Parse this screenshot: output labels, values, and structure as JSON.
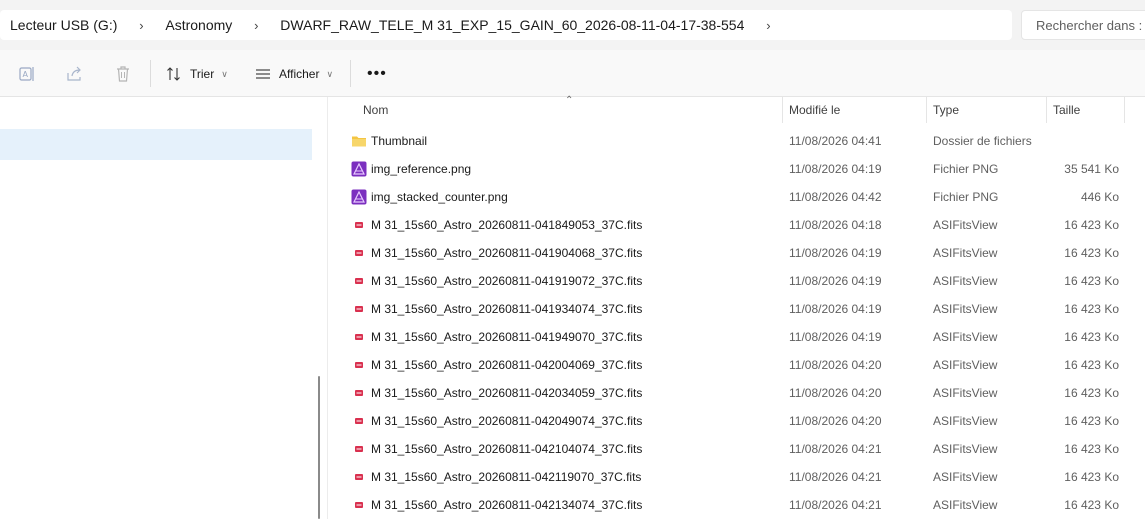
{
  "address": {
    "crumbs": [
      "Lecteur USB (G:)",
      "Astronomy",
      "DWARF_RAW_TELE_M 31_EXP_15_GAIN_60_2026-08-11-04-17-38-554"
    ],
    "search_placeholder": "Rechercher dans : DWARF_RAW"
  },
  "toolbar": {
    "sort_label": "Trier",
    "view_label": "Afficher"
  },
  "columns": {
    "name": "Nom",
    "modified": "Modifié le",
    "type": "Type",
    "size": "Taille"
  },
  "files": [
    {
      "name": "Thumbnail",
      "modified": "11/08/2026 04:41",
      "type": "Dossier de fichiers",
      "size": "",
      "icon": "folder-icon"
    },
    {
      "name": "img_reference.png",
      "modified": "11/08/2026 04:19",
      "type": "Fichier PNG",
      "size": "35 541 Ko",
      "icon": "png-file-icon"
    },
    {
      "name": "img_stacked_counter.png",
      "modified": "11/08/2026 04:42",
      "type": "Fichier PNG",
      "size": "446 Ko",
      "icon": "png-file-icon"
    },
    {
      "name": "M 31_15s60_Astro_20260811-041849053_37C.fits",
      "modified": "11/08/2026 04:18",
      "type": "ASIFitsView",
      "size": "16 423 Ko",
      "icon": "fits-file-icon"
    },
    {
      "name": "M 31_15s60_Astro_20260811-041904068_37C.fits",
      "modified": "11/08/2026 04:19",
      "type": "ASIFitsView",
      "size": "16 423 Ko",
      "icon": "fits-file-icon"
    },
    {
      "name": "M 31_15s60_Astro_20260811-041919072_37C.fits",
      "modified": "11/08/2026 04:19",
      "type": "ASIFitsView",
      "size": "16 423 Ko",
      "icon": "fits-file-icon"
    },
    {
      "name": "M 31_15s60_Astro_20260811-041934074_37C.fits",
      "modified": "11/08/2026 04:19",
      "type": "ASIFitsView",
      "size": "16 423 Ko",
      "icon": "fits-file-icon"
    },
    {
      "name": "M 31_15s60_Astro_20260811-041949070_37C.fits",
      "modified": "11/08/2026 04:19",
      "type": "ASIFitsView",
      "size": "16 423 Ko",
      "icon": "fits-file-icon"
    },
    {
      "name": "M 31_15s60_Astro_20260811-042004069_37C.fits",
      "modified": "11/08/2026 04:20",
      "type": "ASIFitsView",
      "size": "16 423 Ko",
      "icon": "fits-file-icon"
    },
    {
      "name": "M 31_15s60_Astro_20260811-042034059_37C.fits",
      "modified": "11/08/2026 04:20",
      "type": "ASIFitsView",
      "size": "16 423 Ko",
      "icon": "fits-file-icon"
    },
    {
      "name": "M 31_15s60_Astro_20260811-042049074_37C.fits",
      "modified": "11/08/2026 04:20",
      "type": "ASIFitsView",
      "size": "16 423 Ko",
      "icon": "fits-file-icon"
    },
    {
      "name": "M 31_15s60_Astro_20260811-042104074_37C.fits",
      "modified": "11/08/2026 04:21",
      "type": "ASIFitsView",
      "size": "16 423 Ko",
      "icon": "fits-file-icon"
    },
    {
      "name": "M 31_15s60_Astro_20260811-042119070_37C.fits",
      "modified": "11/08/2026 04:21",
      "type": "ASIFitsView",
      "size": "16 423 Ko",
      "icon": "fits-file-icon"
    },
    {
      "name": "M 31_15s60_Astro_20260811-042134074_37C.fits",
      "modified": "11/08/2026 04:21",
      "type": "ASIFitsView",
      "size": "16 423 Ko",
      "icon": "fits-file-icon"
    }
  ],
  "colors": {
    "selection": "#e5f1fb",
    "folder": "#f4c542",
    "png_icon": "#7b2fbf",
    "fits_icon": "#d9304f"
  }
}
